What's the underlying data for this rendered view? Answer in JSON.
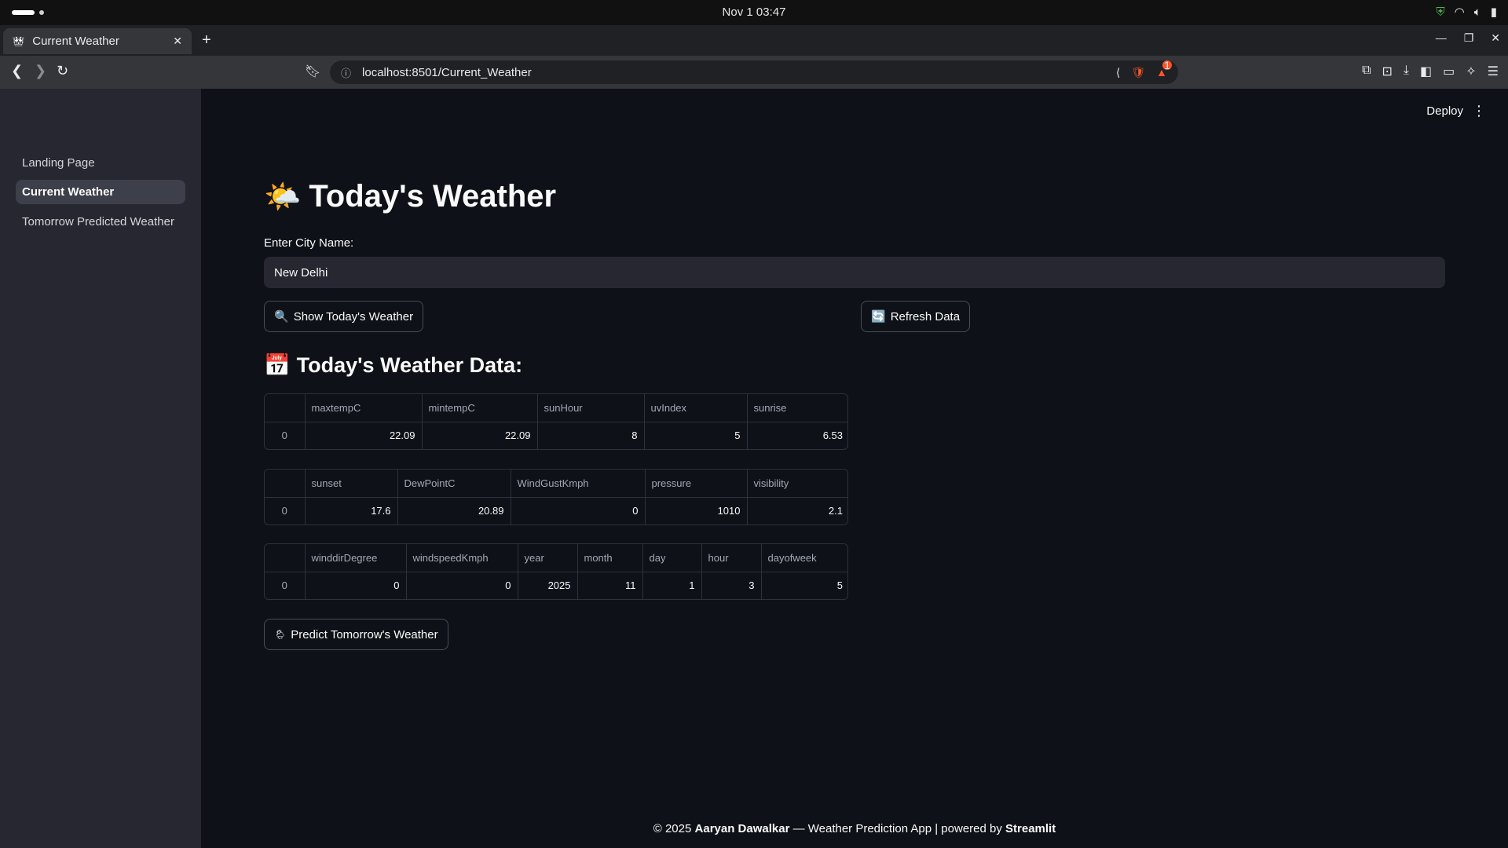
{
  "os": {
    "clock": "Nov 1  03:47",
    "tray_icons": [
      "shield-icon",
      "wifi-icon",
      "volume-icon",
      "battery-icon"
    ]
  },
  "browser": {
    "tab_title": "Current Weather",
    "url": "localhost:8501/Current_Weather",
    "rewards_badge": "1"
  },
  "sidebar": {
    "items": [
      {
        "label": "Landing Page",
        "active": false
      },
      {
        "label": "Current Weather",
        "active": true
      },
      {
        "label": "Tomorrow Predicted Weather",
        "active": false
      }
    ]
  },
  "header": {
    "deploy_label": "Deploy"
  },
  "page": {
    "title_icon": "🌤️",
    "title": "Today's Weather",
    "city_label": "Enter City Name:",
    "city_value": "New Delhi",
    "show_button_icon": "🔍",
    "show_button": "Show Today's Weather",
    "refresh_button_icon": "🔄",
    "refresh_button": "Refresh Data",
    "section_icon": "📅",
    "section_title": "Today's Weather Data:",
    "predict_button_icon": "🌦",
    "predict_button": "Predict Tomorrow's Weather"
  },
  "tables": {
    "t1": {
      "columns": [
        "maxtempC",
        "mintempC",
        "sunHour",
        "uvIndex",
        "sunrise"
      ],
      "rows": [
        [
          "0",
          "22.09",
          "22.09",
          "8",
          "5",
          "6.53"
        ]
      ]
    },
    "t2": {
      "columns": [
        "sunset",
        "DewPointC",
        "WindGustKmph",
        "pressure",
        "visibility"
      ],
      "rows": [
        [
          "0",
          "17.6",
          "20.89",
          "0",
          "1010",
          "2.1"
        ]
      ]
    },
    "t3": {
      "columns": [
        "winddirDegree",
        "windspeedKmph",
        "year",
        "month",
        "day",
        "hour",
        "dayofweek"
      ],
      "rows": [
        [
          "0",
          "0",
          "0",
          "2025",
          "11",
          "1",
          "3",
          "5"
        ]
      ]
    }
  },
  "footer": {
    "copyright": "© 2025 ",
    "author": "Aaryan Dawalkar",
    "middle": " — Weather Prediction App | powered by ",
    "framework": "Streamlit"
  }
}
